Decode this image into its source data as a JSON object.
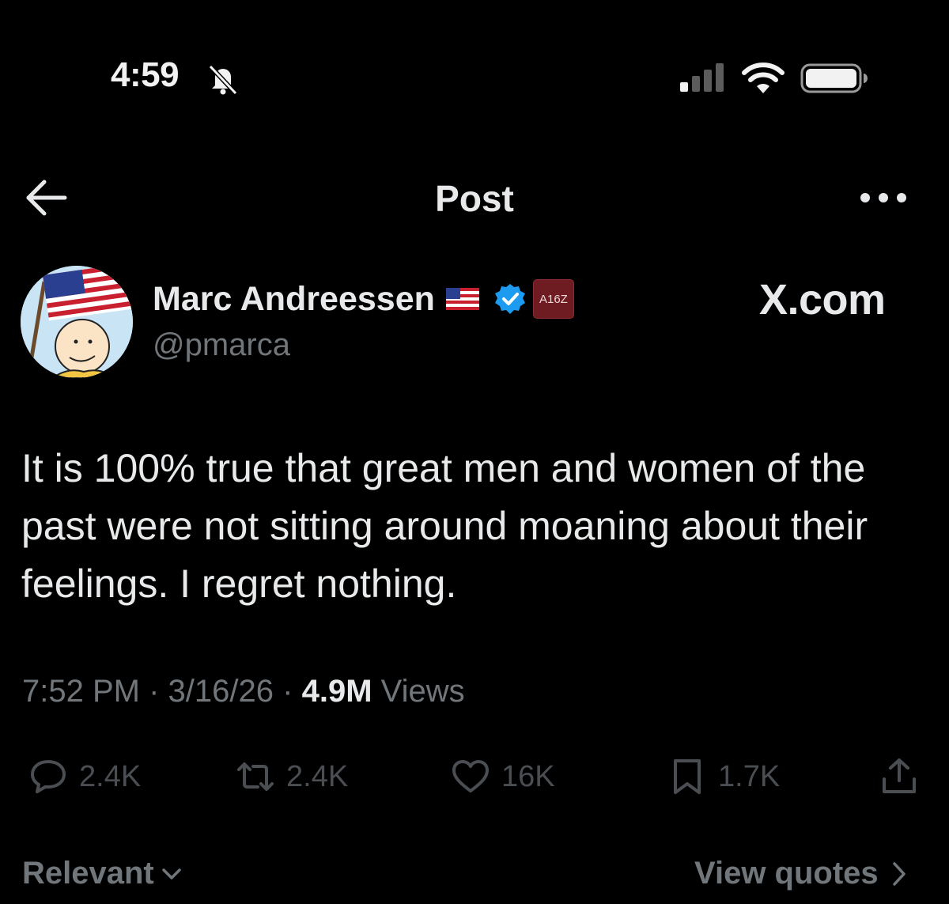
{
  "status_bar": {
    "time": "4:59",
    "icons": [
      "bell-slash-icon",
      "signal-icon",
      "wifi-icon",
      "battery-icon"
    ]
  },
  "header": {
    "title": "Post",
    "back_icon": "arrow-left-icon",
    "more_icon": "more-horizontal-icon"
  },
  "author": {
    "name": "Marc Andreessen",
    "handle": "@pmarca",
    "badge_text": "A16Z",
    "flag_icon": "us-flag-icon",
    "verified_icon": "verified-badge-icon"
  },
  "watermark": "X.com",
  "post": {
    "text": "It is 100% true that great men and women of the past were not sitting around moaning about their feelings. I regret nothing.",
    "time": "7:52 PM",
    "separator": "·",
    "date": "3/16/26",
    "views_count": "4.9M",
    "views_label": "Views"
  },
  "actions": {
    "replies": "2.4K",
    "reposts": "2.4K",
    "likes": "16K",
    "bookmarks": "1.7K"
  },
  "footer": {
    "sort_label": "Relevant",
    "quotes_label": "View quotes"
  },
  "colors": {
    "background": "#000000",
    "text": "#e7e9ea",
    "muted": "#71767b",
    "verified": "#1d9bf0",
    "badge": "#6e1b22"
  }
}
